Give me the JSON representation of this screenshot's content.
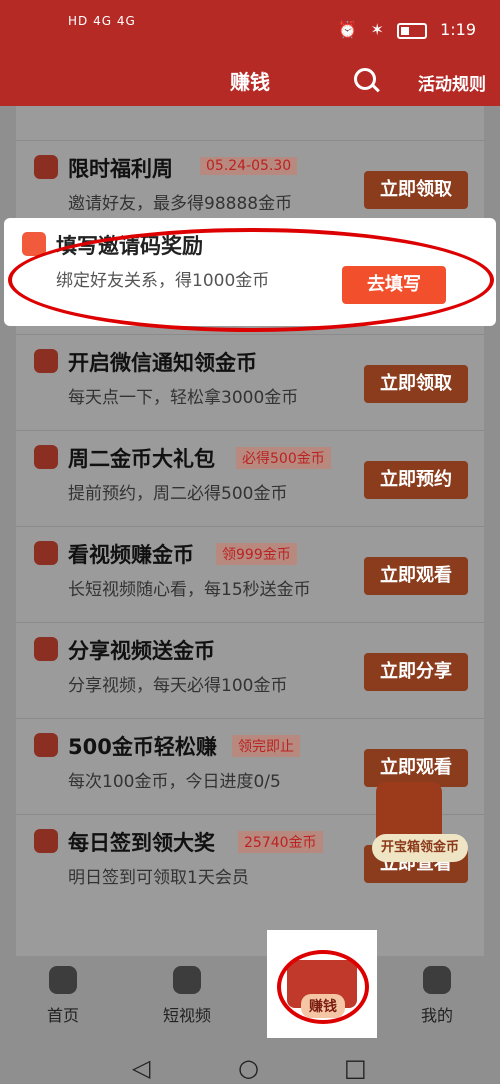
{
  "status": {
    "left": "HD 4G 4G",
    "time": "1:19"
  },
  "header": {
    "title": "赚钱",
    "rules": "活动规则"
  },
  "rows": [
    {
      "title": "限时福利周",
      "badge": "05.24-05.30",
      "sub": "邀请好友，最多得98888金币",
      "button": "立即领取"
    },
    {
      "title": "填写邀请码奖励",
      "sub": "绑定好友关系，得1000金币",
      "button": "去填写"
    },
    {
      "title": "开启微信通知领金币",
      "sub": "每天点一下，轻松拿3000金币",
      "button": "立即领取"
    },
    {
      "title": "周二金币大礼包",
      "badge": "必得500金币",
      "sub": "提前预约，周二必得500金币",
      "button": "立即预约"
    },
    {
      "title": "看视频赚金币",
      "badge": "领999金币",
      "sub": "长短视频随心看，每15秒送金币",
      "button": "立即观看"
    },
    {
      "title": "分享视频送金币",
      "sub": "分享视频，每天必得100金币",
      "button": "立即分享"
    },
    {
      "title": "500金币轻松赚",
      "badge": "领完即止",
      "sub": "每次100金币，今日进度0/5",
      "button": "立即观看"
    },
    {
      "title": "每日签到领大奖",
      "badge": "25740金币",
      "sub": "明日签到可领取1天会员",
      "button": "立即查看"
    }
  ],
  "floating": {
    "chest_label": "开宝箱领金币"
  },
  "nav": {
    "home": "首页",
    "short": "短视频",
    "earn": "赚钱",
    "me": "我的"
  }
}
